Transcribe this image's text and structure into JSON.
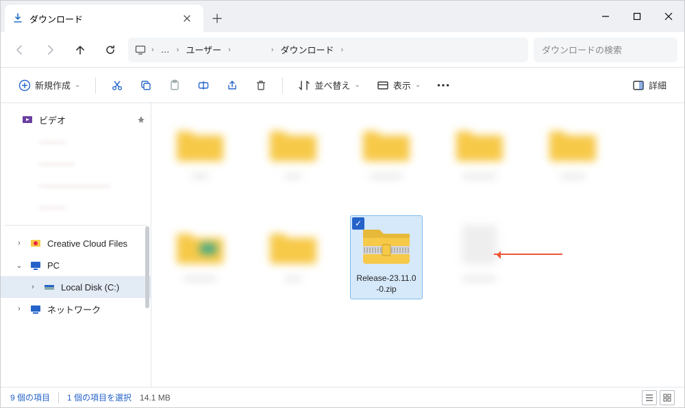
{
  "tab": {
    "title": "ダウンロード"
  },
  "breadcrumbs": {
    "users": "ユーザー",
    "downloads": "ダウンロード"
  },
  "search": {
    "placeholder": "ダウンロードの検索"
  },
  "toolbar": {
    "new": "新規作成",
    "sort": "並べ替え",
    "view": "表示",
    "details": "詳細"
  },
  "nav": {
    "videos": "ビデオ",
    "ccf": "Creative Cloud Files",
    "pc": "PC",
    "local": "Local Disk (C:)",
    "network": "ネットワーク"
  },
  "file": {
    "name_l1": "Release-23.11.0",
    "name_l2": "-0.zip"
  },
  "status": {
    "items": "9 個の項目",
    "selected": "1 個の項目を選択",
    "size": "14.1 MB"
  }
}
